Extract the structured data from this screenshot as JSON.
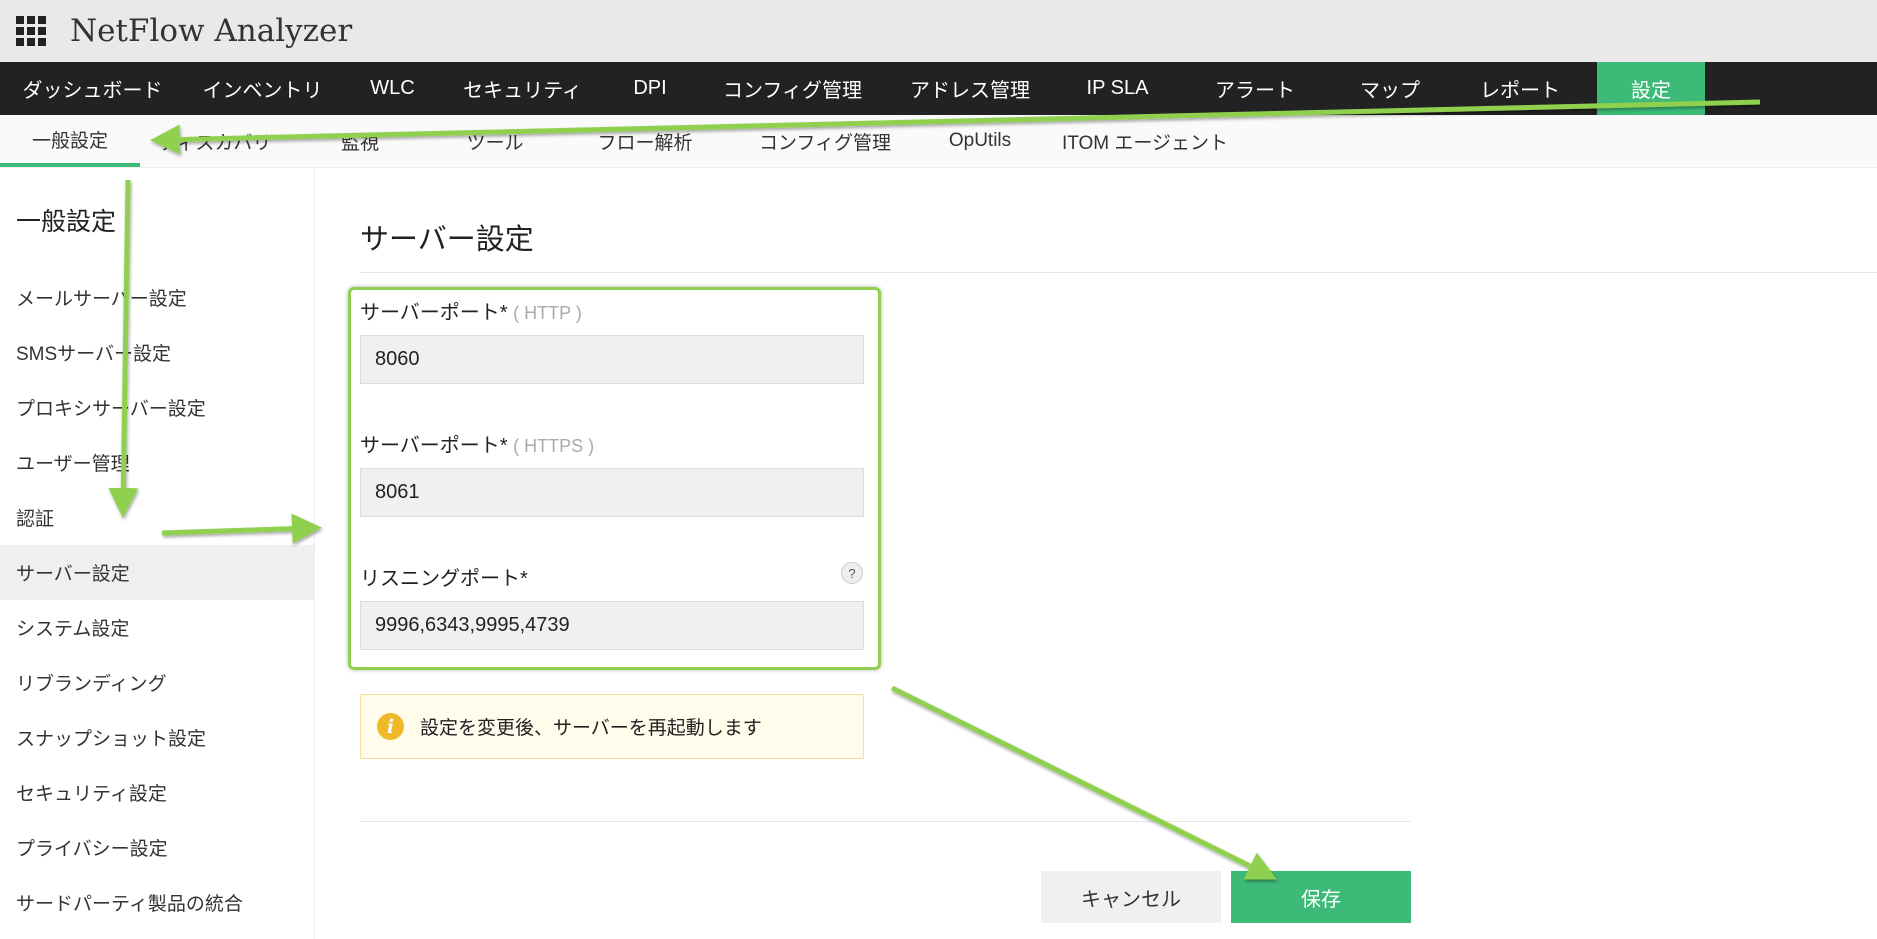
{
  "app": {
    "title": "NetFlow Analyzer"
  },
  "nav": {
    "tabs": [
      "ダッシュボード",
      "インベントリ",
      "WLC",
      "セキュリティ",
      "DPI",
      "コンフィグ管理",
      "アドレス管理",
      "IP SLA",
      "アラート",
      "マップ",
      "レポート",
      "設定"
    ],
    "active": "設定"
  },
  "subnav": {
    "tabs": [
      "一般設定",
      "ディスカバリ",
      "監視",
      "ツール",
      "フロー解析",
      "コンフィグ管理",
      "OpUtils",
      "ITOM エージェント"
    ],
    "active": "一般設定"
  },
  "sidebar": {
    "title": "一般設定",
    "items": [
      "メールサーバー設定",
      "SMSサーバー設定",
      "プロキシサーバー設定",
      "ユーザー管理",
      "認証",
      "サーバー設定",
      "システム設定",
      "リブランディング",
      "スナップショット設定",
      "セキュリティ設定",
      "プライバシー設定",
      "サードパーティ製品の統合"
    ],
    "active": "サーバー設定"
  },
  "main": {
    "title": "サーバー設定",
    "http_label": "サーバーポート*",
    "http_hint": "( HTTP )",
    "http_value": "8060",
    "https_label": "サーバーポート*",
    "https_hint": "( HTTPS )",
    "https_value": "8061",
    "listen_label": "リスニングポート*",
    "listen_value": "9996,6343,9995,4739",
    "help": "?",
    "info_icon": "i",
    "info": "設定を変更後、サーバーを再起動します",
    "cancel": "キャンセル",
    "save": "保存"
  },
  "colors": {
    "accent": "#3dba78",
    "annotation": "#8fd14f"
  }
}
